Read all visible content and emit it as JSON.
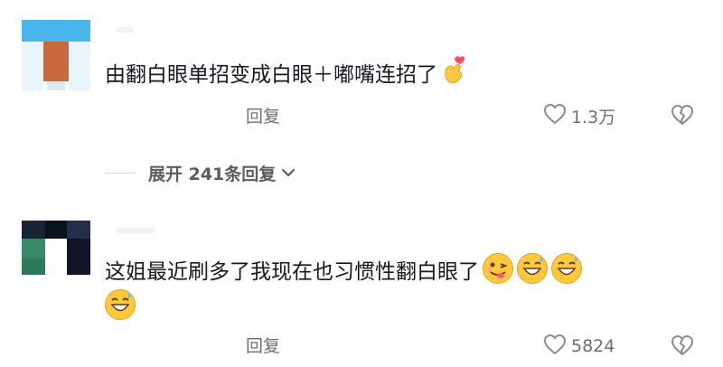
{
  "comments": [
    {
      "text": "由翻白眼单招变成白眼＋嘟嘴连招了",
      "emoji": "heart-fingers-emoji",
      "reply_label": "回复",
      "likes": "1.3万",
      "expand_label": "展开 241条回复"
    },
    {
      "text": "这姐最近刷多了我现在也习惯性翻白眼了",
      "emojis": [
        "winking-tongue-emoji",
        "grinning-sweat-emoji",
        "grinning-sweat-emoji",
        "grinning-sweat-emoji"
      ],
      "reply_label": "回复",
      "likes": "5824"
    }
  ],
  "colors": {
    "text": "#161823",
    "secondary": "#6e6f75",
    "emoji_yellow": "#ffc83d"
  }
}
